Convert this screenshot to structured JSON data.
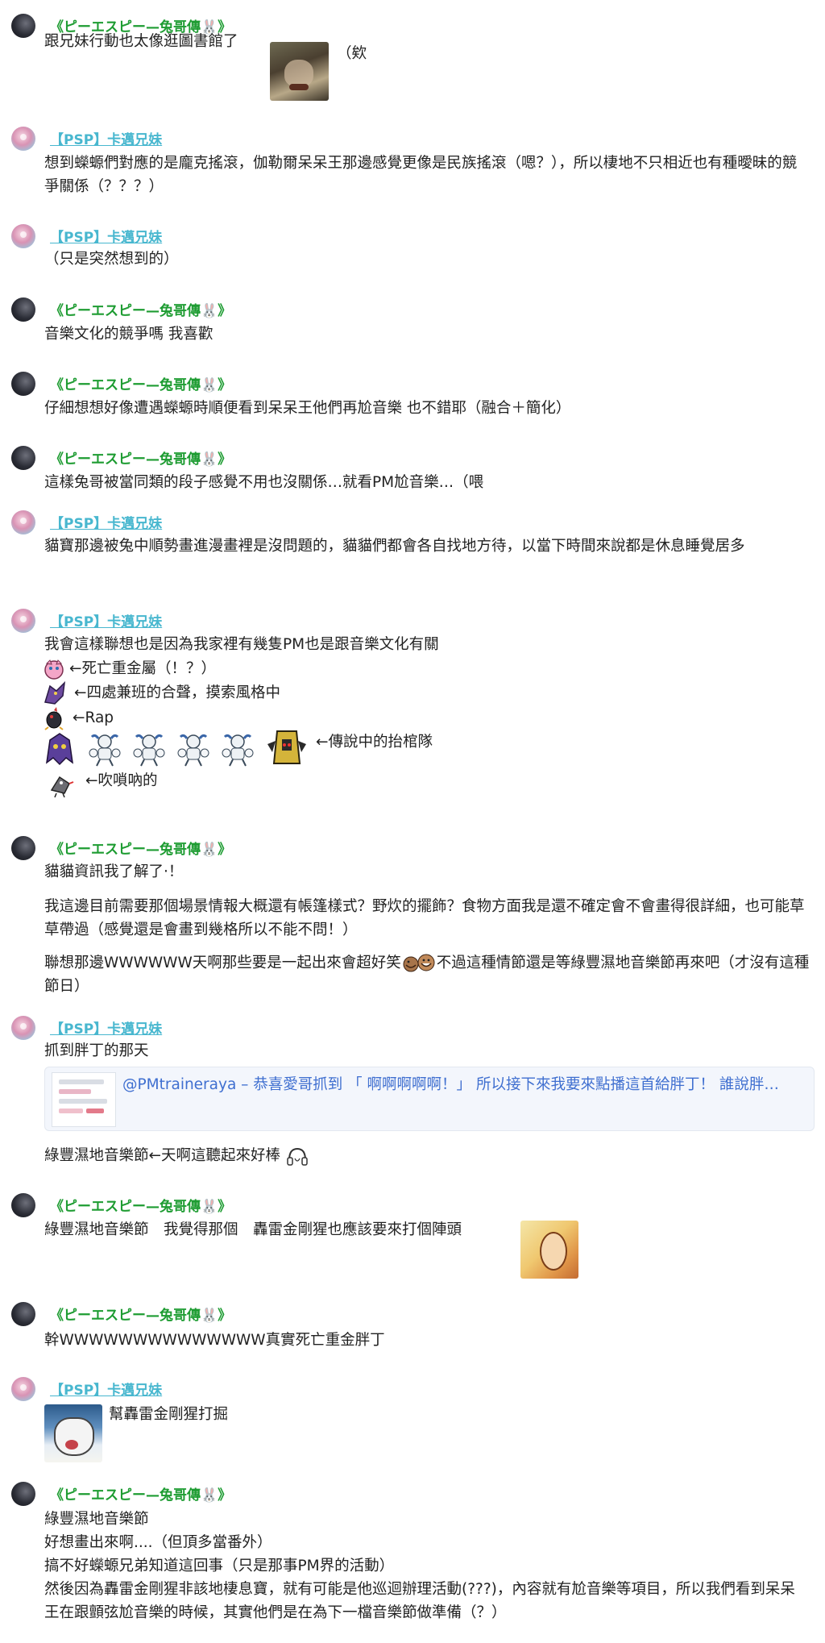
{
  "users": {
    "a": "《ピーエスピー—兔哥傳🐰》",
    "b": "【PSP】卡邁兄妹"
  },
  "messages": {
    "m1": {
      "line1": "跟兄妹行動也太像逛圖書館了",
      "line1_tail": "（欸"
    },
    "m2": {
      "text": "想到蠑螈們對應的是龐克搖滾，伽勒爾呆呆王那邊感覺更像是民族搖滾（嗯？），所以棲地不只相近也有種曖昧的競爭關係（？？？）"
    },
    "m3": {
      "text": "（只是突然想到的）"
    },
    "m4": {
      "text": "音樂文化的競爭嗎 我喜歡"
    },
    "m5": {
      "text": "仔細想想好像遭遇蠑螈時順便看到呆呆王他們再尬音樂 也不錯耶（融合＋簡化）"
    },
    "m6": {
      "text": "這樣兔哥被當同類的段子感覺不用也沒關係…就看PM尬音樂…（喂"
    },
    "m7": {
      "text": "貓寶那邊被兔中順勢畫進漫畫裡是沒問題的，貓貓們都會各自找地方待，以當下時間來說都是休息睡覺居多"
    },
    "m8": {
      "intro": "我會這樣聯想也是因為我家裡有幾隻PM也是跟音樂文化有關",
      "row1": "←死亡重金屬（！？）",
      "row2": "←四處兼班的合聲，摸索風格中",
      "row3": "←Rap",
      "row4": "←傳說中的抬棺隊",
      "row5": "←吹嗩吶的"
    },
    "m9": {
      "p1": "貓貓資訊我了解了‧！",
      "p2": "我這邊目前需要那個場景情報大概還有帳篷樣式？野炊的擺飾？食物方面我是還不確定會不會畫得很詳細，也可能草草帶過（感覺還是會畫到幾格所以不能不問！）",
      "p3a": "聯想那邊WWWWWW天啊那些要是一起出來會超好笑",
      "p3b": "不過這種情節還是等綠豐濕地音樂節再來吧（才沒有這種節日）"
    },
    "m10": {
      "line1": "抓到胖丁的那天",
      "embed": "@PMtraineraya – 恭喜愛哥抓到 「 啊啊啊啊啊！」 所以接下來我要來點播這首給胖丁！ 誰說胖…",
      "line2": "綠豐濕地音樂節←天啊這聽起來好棒"
    },
    "m11": {
      "text": "綠豐濕地音樂節　我覺得那個　轟雷金剛猩也應該要來打個陣頭"
    },
    "m12": {
      "text": "幹WWWWWWWWWWWWWW真實死亡重金胖丁"
    },
    "m13": {
      "text": "幫轟雷金剛猩打掘"
    },
    "m14": {
      "l1": "綠豐濕地音樂節",
      "l2": "好想畫出來啊....（但頂多當番外）",
      "l3": "搞不好蠑螈兄弟知道這回事（只是那事PM界的活動）",
      "l4": "然後因為轟雷金剛猩非該地棲息寶，就有可能是他巡迴辦理活動(???)，內容就有尬音樂等項目，所以我們看到呆呆王在跟顫弦尬音樂的時候，其實他們是在為下一檔音樂節做準備（？）"
    }
  },
  "colors": {
    "name_a": "#1e9c32",
    "name_b": "#48b7cf",
    "link": "#3f6fd0"
  },
  "icons": {
    "headphone": "headphone-emoji-icon",
    "laugh": "laughing-emoji-icon"
  }
}
